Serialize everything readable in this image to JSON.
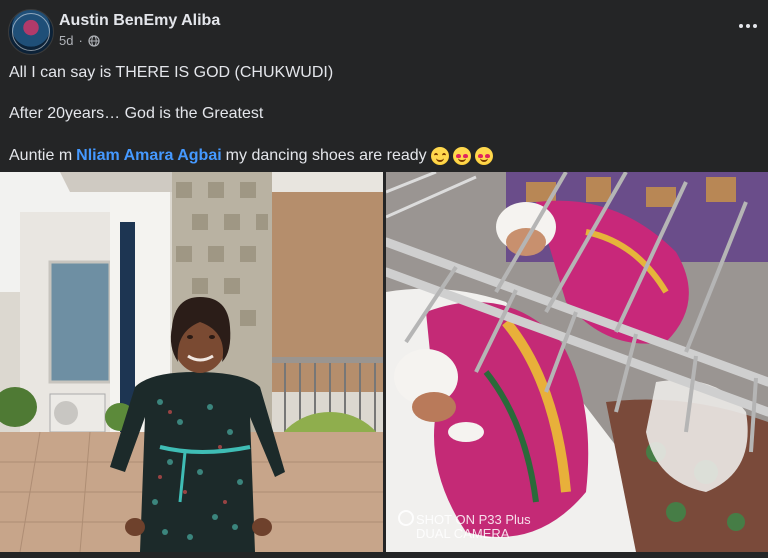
{
  "post": {
    "author": "Austin BenEmy Aliba",
    "time": "5d",
    "separator": "·",
    "audience_icon": "globe-icon",
    "more_icon": "more-options-icon",
    "line1": "All I can say is THERE IS GOD (CHUKWUDI)",
    "line2": "After 20years… God is the Greatest",
    "line3_prefix": "Auntie m",
    "line3_mention": "Nliam Amara Agbai",
    "line3_suffix": "my dancing shoes are ready",
    "emojis": [
      "smiling-face-icon",
      "smiling-face-with-hearts-icon",
      "smiling-face-with-hearts-icon"
    ]
  },
  "photos": {
    "left_alt": "woman standing in front of a house",
    "right_alt": "two newborn babies wrapped in cloth in a hospital cot",
    "watermark_line1": "SHOT ON P33 Plus",
    "watermark_line2": "DUAL CAMERA"
  },
  "colors": {
    "background": "#242526",
    "text": "#e4e6eb",
    "secondary": "#b0b3b8",
    "mention": "#4599ff"
  }
}
